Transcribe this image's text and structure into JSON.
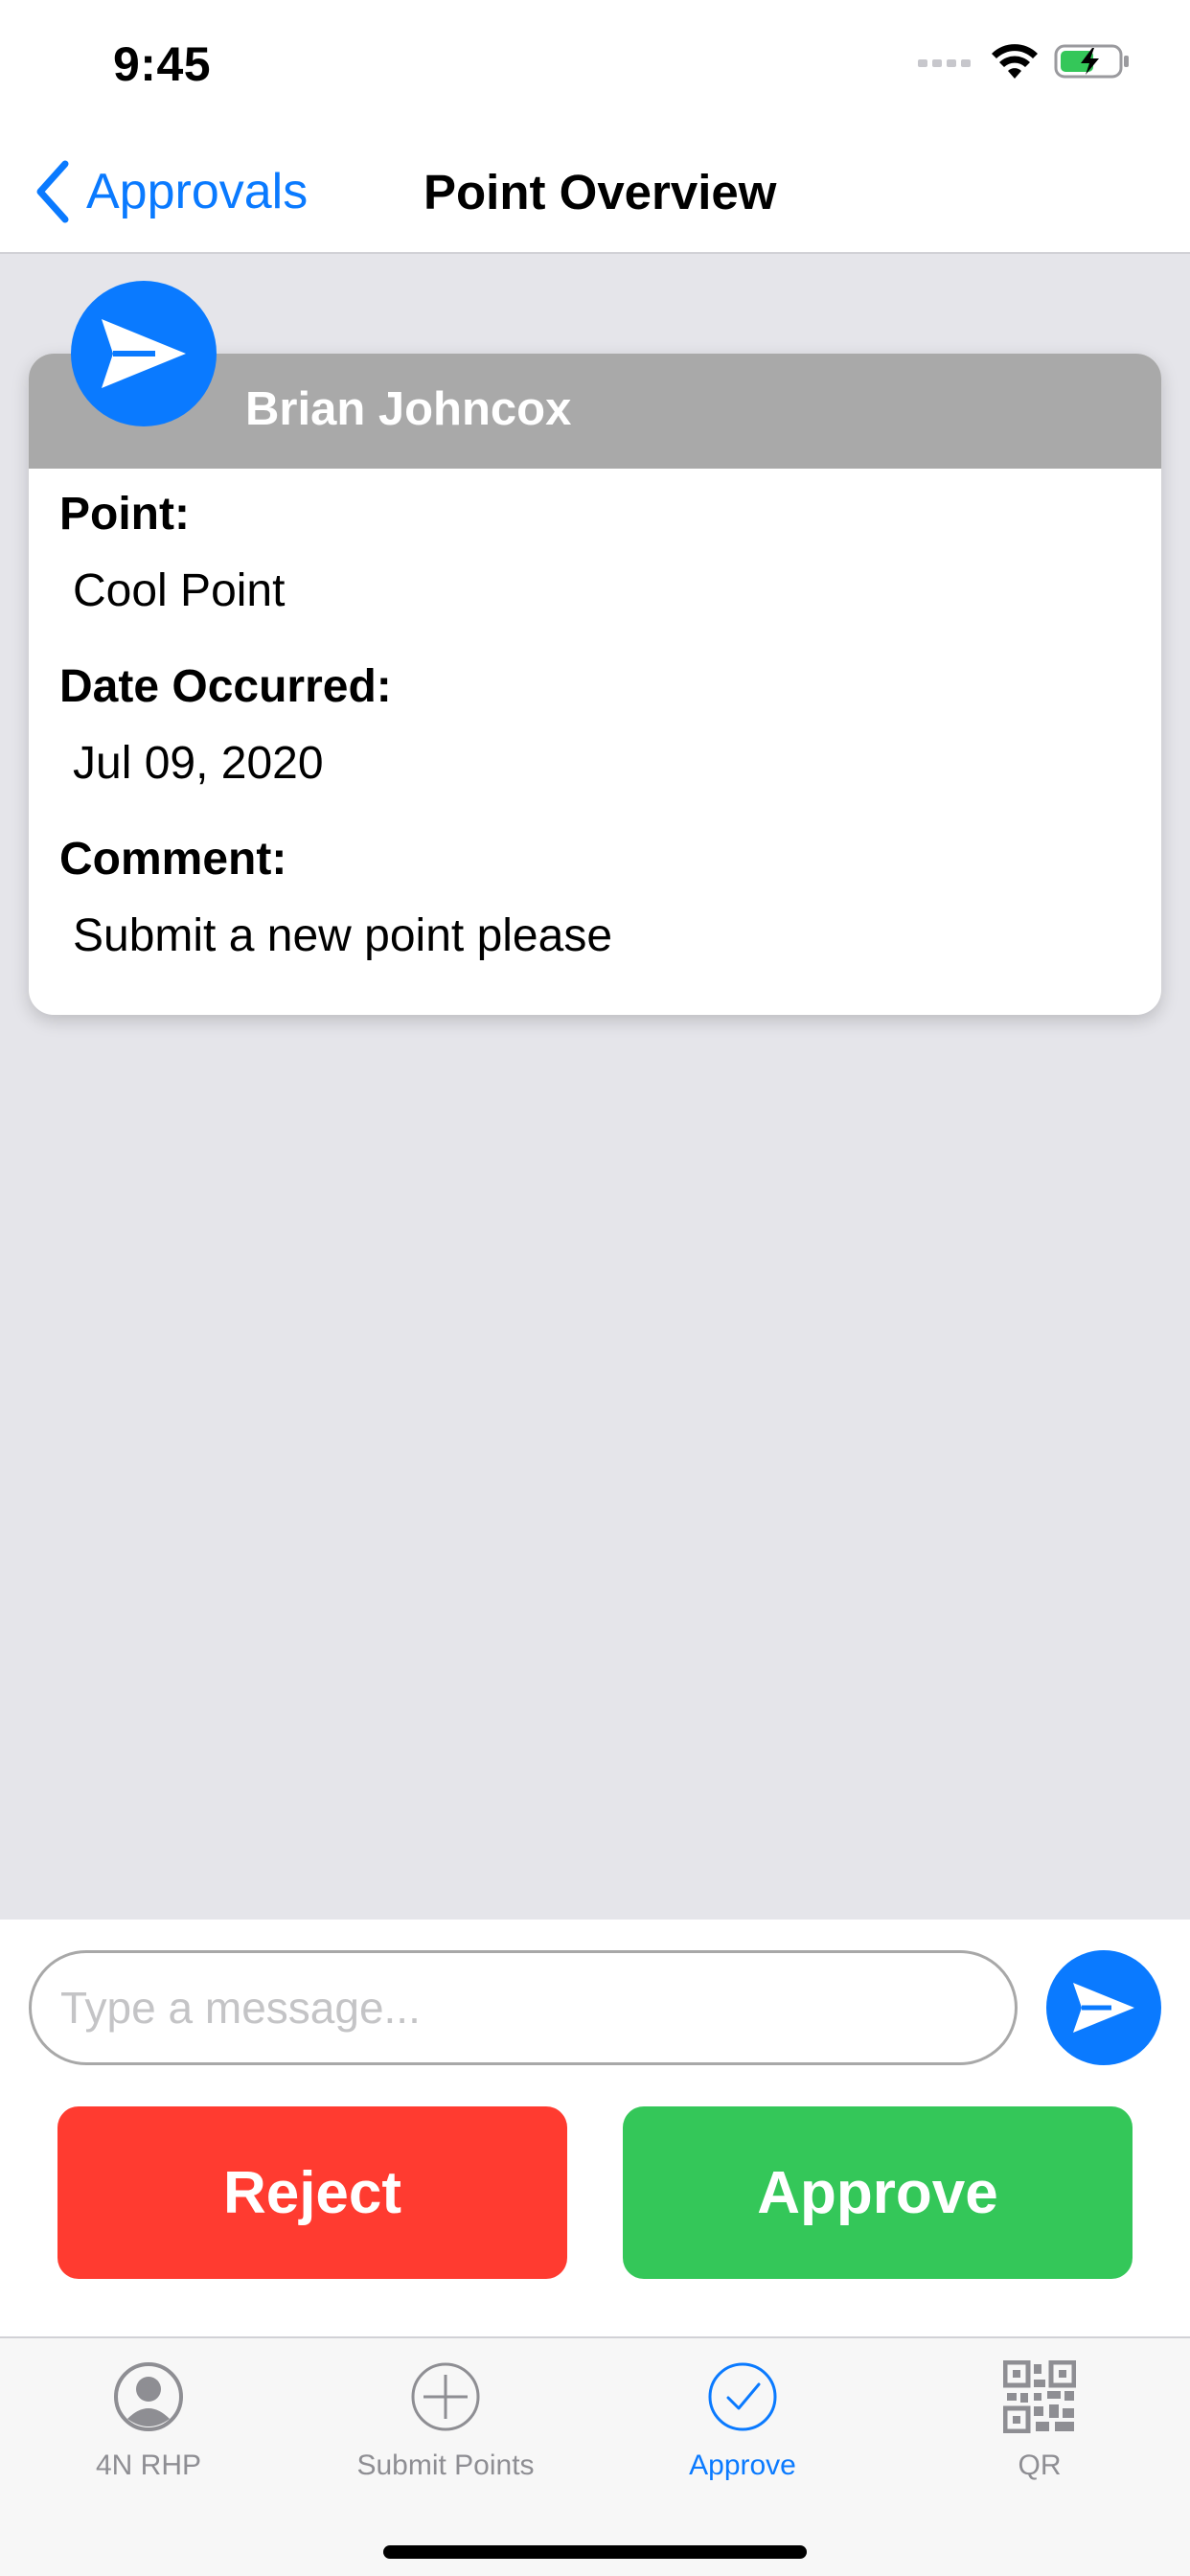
{
  "status_bar": {
    "time": "9:45",
    "icons": [
      "signal-icon",
      "wifi-icon",
      "battery-charging-icon"
    ]
  },
  "nav": {
    "back_label": "Approvals",
    "title": "Point Overview"
  },
  "card": {
    "avatar_icon": "paper-plane-icon",
    "name": "Brian Johncox",
    "fields": [
      {
        "label": "Point:",
        "value": "Cool Point"
      },
      {
        "label": "Date Occurred:",
        "value": "Jul 09, 2020"
      },
      {
        "label": "Comment:",
        "value": "Submit a new point please"
      }
    ]
  },
  "composer": {
    "placeholder": "Type a message...",
    "value": "",
    "send_icon": "send-icon"
  },
  "actions": {
    "reject_label": "Reject",
    "approve_label": "Approve"
  },
  "tabs": [
    {
      "label": "4N RHP",
      "icon": "person-circle-icon",
      "active": false
    },
    {
      "label": "Submit Points",
      "icon": "plus-circle-icon",
      "active": false
    },
    {
      "label": "Approve",
      "icon": "checkmark-circle-icon",
      "active": true
    },
    {
      "label": "QR",
      "icon": "qr-code-icon",
      "active": false
    }
  ],
  "colors": {
    "accent": "#0a7aff",
    "reject": "#ff3b30",
    "approve": "#34c759",
    "card_header": "#a9a9a9",
    "background": "#e5e5ea"
  }
}
